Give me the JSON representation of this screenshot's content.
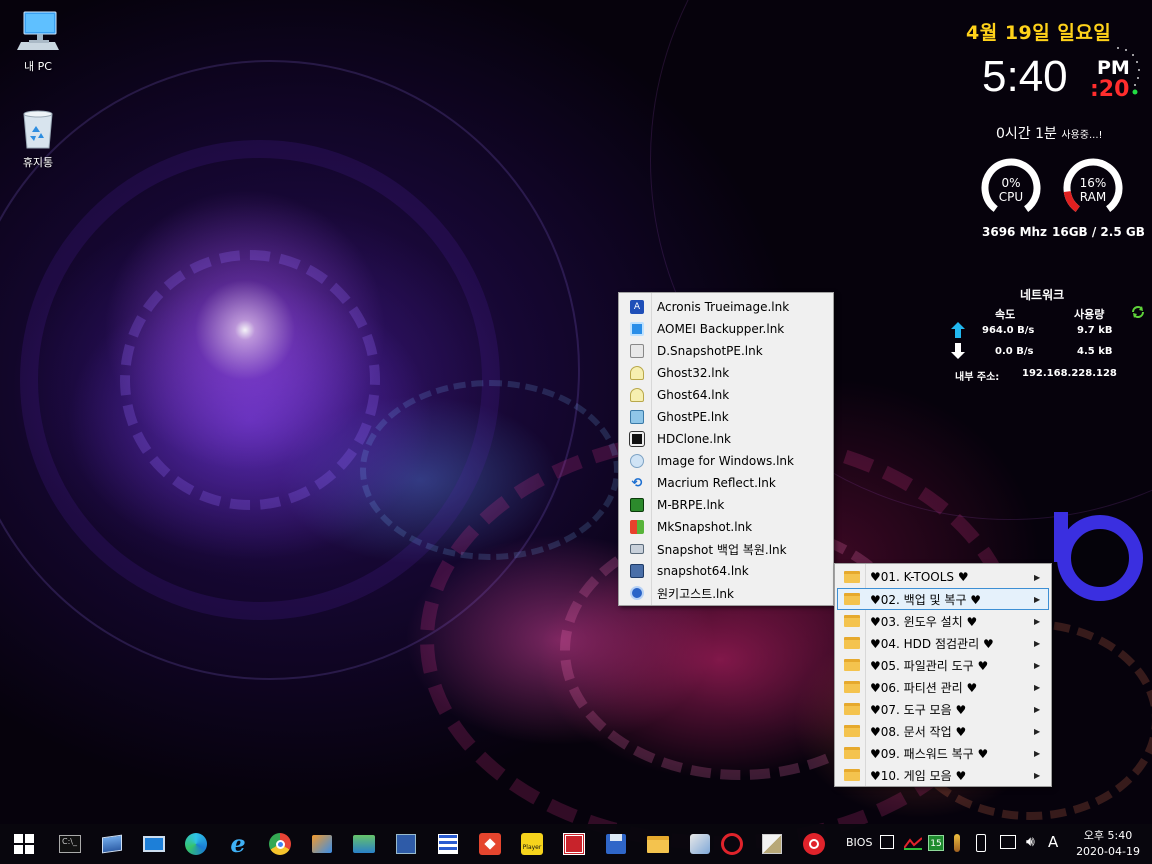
{
  "desktop": {
    "icons": [
      {
        "label": "내 PC",
        "icon": "computer-icon"
      },
      {
        "label": "휴지통",
        "icon": "recycle-bin-icon"
      }
    ]
  },
  "widgets": {
    "date": "4월 19일 일요일",
    "time": "5:40",
    "ampm": "PM",
    "seconds": ":20",
    "uptime_main": "0시간 1분",
    "uptime_suffix": "사용중...!",
    "cpu": {
      "percent_label": "0%",
      "name": "CPU",
      "percent": 0,
      "sub": "3696 Mhz"
    },
    "ram": {
      "percent_label": "16%",
      "name": "RAM",
      "percent": 16,
      "sub": "16GB / 2.5 GB"
    },
    "network": {
      "title": "네트워크",
      "col_speed": "속도",
      "col_usage": "사용량",
      "up_speed": "964.0 B/s",
      "up_usage": "9.7 kB",
      "down_speed": "0.0 B/s",
      "down_usage": "4.5 kB",
      "ip_label": "내부 주소:",
      "ip": "192.168.228.128"
    }
  },
  "submenu": {
    "items": [
      "Acronis Trueimage.lnk",
      "AOMEI Backupper.lnk",
      "D.SnapshotPE.lnk",
      "Ghost32.lnk",
      "Ghost64.lnk",
      "GhostPE.lnk",
      "HDClone.lnk",
      "Image for Windows.lnk",
      "Macrium Reflect.lnk",
      "M-BRPE.lnk",
      "MkSnapshot.lnk",
      "Snapshot 백업 복원.lnk",
      "snapshot64.lnk",
      "원키고스트.lnk"
    ]
  },
  "mainmenu": {
    "highlighted_index": 1,
    "items": [
      "♥01. K-TOOLS ♥",
      "♥02. 백업 및 복구 ♥",
      "♥03. 윈도우 설치 ♥",
      "♥04. HDD 점검관리 ♥",
      "♥05. 파일관리 도구 ♥",
      "♥06. 파티션 관리 ♥",
      "♥07. 도구 모음 ♥",
      "♥08. 문서 작업 ♥",
      "♥09. 패스워드 복구 ♥",
      "♥10. 게임 모음 ♥"
    ]
  },
  "taskbar": {
    "tray_bios": "BIOS",
    "tray_badge": "15",
    "tray_ime": "A",
    "clock_time": "오후 5:40",
    "clock_date": "2020-04-19"
  },
  "colors": {
    "date": "#ffd21a",
    "seconds": "#ff2d2d",
    "ram_arc": "#e02020",
    "menu_highlight": "#e5f1fb"
  }
}
